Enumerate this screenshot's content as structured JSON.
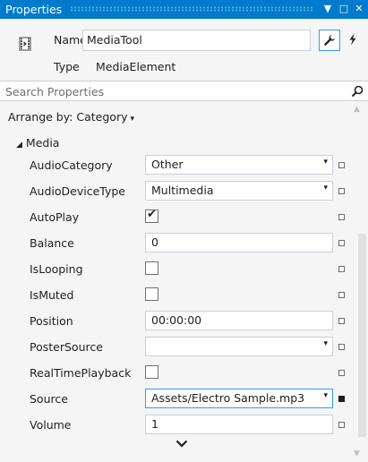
{
  "window": {
    "title": "Properties",
    "pin_glyph": "▼",
    "maximize_glyph": "□",
    "close_glyph": "✕"
  },
  "header": {
    "name_label": "Name",
    "name_value": "MediaTool",
    "type_label": "Type",
    "type_value": "MediaElement",
    "object_icon": "media-element-icon",
    "properties_button_icon": "wrench-icon",
    "events_button_icon": "lightning-icon"
  },
  "search": {
    "placeholder": "Search Properties",
    "icon": "search-icon"
  },
  "arrange": {
    "label": "Arrange by: Category",
    "caret": "▾"
  },
  "category": {
    "expander": "◢",
    "name": "Media"
  },
  "properties": [
    {
      "name": "AudioCategory",
      "kind": "combo",
      "value": "Other",
      "marker": "default"
    },
    {
      "name": "AudioDeviceType",
      "kind": "combo",
      "value": "Multimedia",
      "marker": "default"
    },
    {
      "name": "AutoPlay",
      "kind": "check",
      "checked": true,
      "check_glyph": "✔",
      "marker": "default"
    },
    {
      "name": "Balance",
      "kind": "text",
      "value": "0",
      "marker": "default"
    },
    {
      "name": "IsLooping",
      "kind": "check",
      "checked": false,
      "check_glyph": "",
      "marker": "default"
    },
    {
      "name": "IsMuted",
      "kind": "check",
      "checked": false,
      "check_glyph": "",
      "marker": "default"
    },
    {
      "name": "Position",
      "kind": "text",
      "value": "00:00:00",
      "marker": "default"
    },
    {
      "name": "PosterSource",
      "kind": "combo",
      "value": "",
      "marker": "default"
    },
    {
      "name": "RealTimePlayback",
      "kind": "check",
      "checked": false,
      "check_glyph": "",
      "marker": "default"
    },
    {
      "name": "Source",
      "kind": "combo",
      "value": "Assets/Electro Sample.mp3",
      "marker": "set"
    },
    {
      "name": "Volume",
      "kind": "text",
      "value": "1",
      "marker": "default"
    }
  ],
  "dropdown_glyph": "▾",
  "scroll": {
    "up_glyph": "▲",
    "down_glyph": "▼"
  },
  "colors": {
    "titlebar": "#007acc",
    "panel": "#f5f5f5",
    "input_border": "#cccedb",
    "selected_border": "#3399ff"
  }
}
